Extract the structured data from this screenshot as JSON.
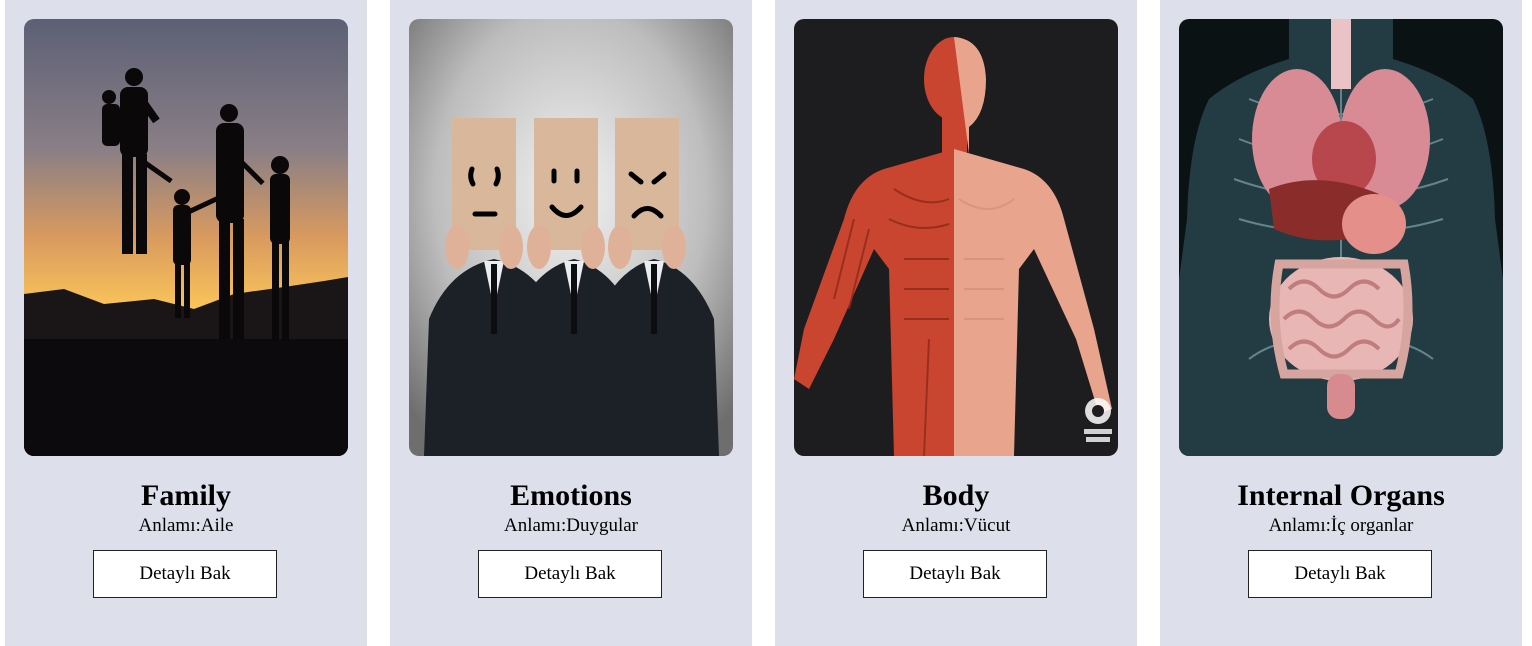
{
  "cards": [
    {
      "image_alt": "family-silhouette-sunset",
      "title": "Family",
      "meaning": "Anlamı:Aile",
      "button_label": "Detaylı Bak"
    },
    {
      "image_alt": "emotions-faces",
      "title": "Emotions",
      "meaning": "Anlamı:Duygular",
      "button_label": "Detaylı Bak"
    },
    {
      "image_alt": "body-muscle-anatomy",
      "title": "Body",
      "meaning": "Anlamı:Vücut",
      "button_label": "Detaylı Bak"
    },
    {
      "image_alt": "internal-organs-xray",
      "title": "Internal Organs",
      "meaning": "Anlamı:İç organlar",
      "button_label": "Detaylı Bak"
    }
  ],
  "colors": {
    "card_background": "#dde0ea",
    "page_background": "#ffffff"
  }
}
